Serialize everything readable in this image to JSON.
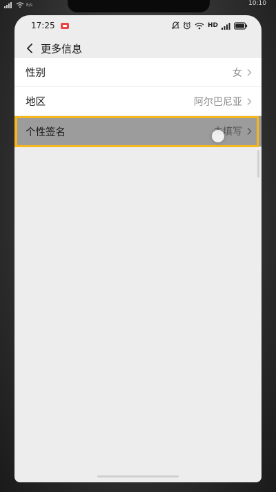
{
  "outer_status": {
    "time": "10:10",
    "network": "E/s"
  },
  "status_bar": {
    "time": "17:25",
    "network": "HD"
  },
  "header": {
    "title": "更多信息"
  },
  "rows": [
    {
      "label": "性别",
      "value": "女"
    },
    {
      "label": "地区",
      "value": "阿尔巴尼亚"
    },
    {
      "label": "个性签名",
      "value": "未填写"
    }
  ],
  "colors": {
    "highlight_border": "#f5b71c",
    "highlight_bg": "#9c9c9c",
    "screen_bg": "#ededed",
    "recording_badge": "#e94545"
  }
}
